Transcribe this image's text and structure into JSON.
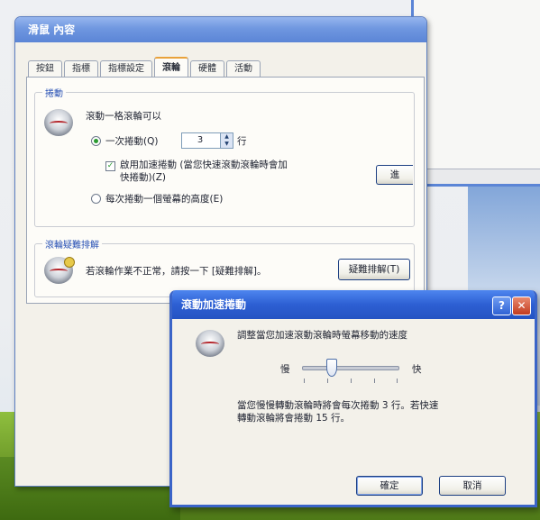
{
  "main_window": {
    "title": "滑鼠 內容",
    "tabs": [
      "按鈕",
      "指標",
      "指標設定",
      "滾輪",
      "硬體",
      "活動"
    ],
    "active_tab_index": 3,
    "scroll_group": {
      "title": "捲動",
      "description": "滾動一格滾輪可以",
      "option_lines_label": "一次捲動(Q)",
      "lines_value": "3",
      "lines_unit": "行",
      "accel_checkbox_label_line1": "啟用加速捲動 (當您快速滾動滾輪時會加",
      "accel_checkbox_label_line2": "快捲動)(Z)",
      "accel_checked": true,
      "option_screen_label": "每次捲動一個螢幕的高度(E)",
      "selected_option": "lines",
      "setting_button_label": "進"
    },
    "troubleshoot_group": {
      "title": "滾輪疑難排解",
      "text": "若滾輪作業不正常，請按一下 [疑難排解]。",
      "button_label": "疑難排解(T)"
    }
  },
  "background_window": {
    "scroll_arrow": "<"
  },
  "dialog": {
    "title": "滾動加速捲動",
    "help_glyph": "?",
    "close_glyph": "✕",
    "description": "調整當您加速滾動滾輪時螢幕移動的速度",
    "slider_slow_label": "慢",
    "slider_fast_label": "快",
    "slider_position": 0.28,
    "info_line1": "當您慢慢轉動滾輪時將會每次捲動 3 行。若快速",
    "info_line2": "轉動滾輪將會捲動 15 行。",
    "ok_label": "確定",
    "cancel_label": "取消"
  },
  "colors": {
    "titlebar_blue": "#5b85d6",
    "dialog_title_blue": "#2d5fd3",
    "group_title_blue": "#2750b4",
    "active_tab_accent": "#e9a23b"
  }
}
